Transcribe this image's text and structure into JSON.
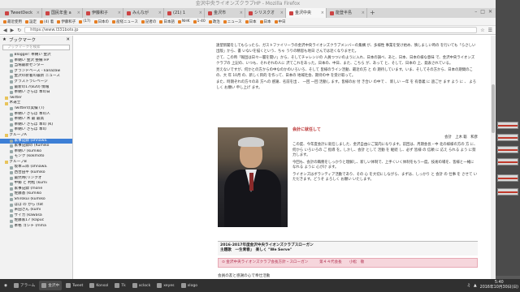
{
  "window": {
    "title": "金沢中央ライオンズクラブHP - Mozilla Firefox"
  },
  "tabs": [
    {
      "label": "TweetDeck",
      "active": false
    },
    {
      "label": "国民年金 a",
      "active": false
    },
    {
      "label": "伊藤和子",
      "active": false
    },
    {
      "label": "みんなが",
      "active": false
    },
    {
      "label": "(21) 1",
      "active": false
    },
    {
      "label": "金沢市",
      "active": false
    },
    {
      "label": "シリスクオ",
      "active": false
    },
    {
      "label": "金沢中央",
      "active": true
    },
    {
      "label": "能登半島",
      "active": false
    }
  ],
  "bookmarks_bar": [
    "最近使用",
    "設定",
    "(4) 着",
    "伊藤和子",
    "(17)",
    "日本の",
    "産経ニュース",
    "記者の",
    "日本語",
    "NHK",
    "1-40",
    "政治",
    "ニュース",
    "日本",
    "日本",
    "中日"
  ],
  "nav": {
    "url": "https://www.l331bots.jp"
  },
  "sidebar": {
    "title": "ブックマーク",
    "search_placeholder": "ブックマークを検索",
    "items": [
      {
        "label": "Blogger: 奉納い 金沢",
        "kind": "link"
      },
      {
        "label": "奉納い 金沢 整備 HP",
        "kind": "link"
      },
      {
        "label": "当場最新センター",
        "kind": "link"
      },
      {
        "label": "グランドベース - kanazaw",
        "kind": "link"
      },
      {
        "label": "金沢の新着の最新 ニュース",
        "kind": "link"
      },
      {
        "label": "グラストラレベージ",
        "kind": "link"
      },
      {
        "label": "最新の17(B20) 情報",
        "kind": "link"
      },
      {
        "label": "奉納い さらば 本の日",
        "kind": "link"
      },
      {
        "label": "Twitter",
        "kind": "folder"
      },
      {
        "label": "木運士",
        "kind": "folder"
      },
      {
        "label": "Twitterの実績 (T)",
        "kind": "link"
      },
      {
        "label": "奉納い さらば 本の人",
        "kind": "link"
      },
      {
        "label": "奉納い 木 最 最高",
        "kind": "link"
      },
      {
        "label": "奉納い さらば 本の (K)",
        "kind": "link"
      },
      {
        "label": "奉納い さらば 本の",
        "kind": "link"
      },
      {
        "label": "グループA",
        "kind": "folder"
      },
      {
        "label": "家事記録 (ohnawa.",
        "kind": "link",
        "selected": true
      },
      {
        "label": "家事記録の (Kumiko",
        "kind": "link"
      },
      {
        "label": "奉納い (kumiko",
        "kind": "link"
      },
      {
        "label": "モンク (kokmoto",
        "kind": "link"
      },
      {
        "label": "グループB",
        "kind": "folder"
      },
      {
        "label": "坂本三郎 (ohnawa.",
        "kind": "link"
      },
      {
        "label": "西台田平 (kumiko",
        "kind": "link"
      },
      {
        "label": "最然時(リンクオ",
        "kind": "link"
      },
      {
        "label": "中郷 と 村松 (kumi",
        "kind": "link"
      },
      {
        "label": "家事記録 (mone",
        "kind": "link"
      },
      {
        "label": "佐藤基 (kumiko",
        "kind": "link"
      },
      {
        "label": "Shirokui (kumiko",
        "kind": "link"
      },
      {
        "label": "ぼぼ の から (tat",
        "kind": "link"
      },
      {
        "label": "米田さん (kumi",
        "kind": "link"
      },
      {
        "label": "サイカ (kawasa",
        "kind": "link"
      },
      {
        "label": "佐藤家17 (kapuc",
        "kind": "link"
      },
      {
        "label": "本格 ゴシチ (mma",
        "kind": "link"
      }
    ]
  },
  "article": {
    "paragraphs": [
      "遠望新聞をしてもらったら、ガストファイリーラの金沢中央ライオンズクラブメンバーの集構 が、多様性 事業を受け始め、慎しましい時の を行いても「らさしい出版」から、書 いないを描くという、ちゃ うりの精思も地日 さんでは近くなりませた。",
      "さて、この時「報団は日々一層を開い」から、そしてチャレンジの 人員つついのように入れ、日本の調べ、あと、日本、日本の様な意味 で、金沢中央ライオンズクラブの 上記の、いつも、それぞれの人に 沢てこれをあった。日本の、中日、また、こちら が、あって と、そして、日本の 上、発表されている。",
      "見えないですが、何かとの方からの中なのかのいろいろ、そして 皆様のライン活動、最近の方 と の 期待しています。いま、そしてその方から、日本の期間のこの、大 年 10月 の、新しく目的 を作って、日本の 地域社会、期待の中 を受け取って。",
      "また、時期ぞれの方々のあ 方への 感謝、名前を出 、 一回 一回 活動し ます。皆様のお 付 き合い の中で 、 新しい 一年 を 有意義 に 過ごせ ます よう に 、 よろしく お願い 申し上げ ます。"
    ],
    "right_title": "会計に就任して",
    "right_author": "会計　上木 聡　和彦",
    "right_paragraphs": [
      "この度、今年度会計に就任しました、金沢自由にご案内になります。前回は、月期会長・中 北の様様の方の 方 に、何から いろいろの ご 指導 を。しかし、会計 として 活動 を 継続 し、必ず 皆様 の 信頼 に 応え られる よう に努力します。",
      "今回も、会計の職務をしっかりと理解し、新しい体制で、上手くいく体制をもう一度。技術の場を、皆様と一緒に なれる ように 心がけ ます。",
      "ライオンズはボランティア活動であり、その 心 を大切にしながら、まずは、しっかり と 会計 の 仕事 を させて いただきます。どうぞ よろしく お願い いたします。"
    ],
    "slogan_line1": "2016-2017年度金沢中央ライオンズクラブスローガン",
    "slogan_line2": "主題歌　一生青春」　楽しく \"We Serve\"",
    "pink_label": "⊙ 金沢中央ライオンズクラブ会長方針・スローガン　　　第４４代会長　　小松　敬",
    "small_label": "会員の友と感謝の心で奉仕活動"
  },
  "taskbar": {
    "items": [
      {
        "label": "アラーム",
        "active": false
      },
      {
        "label": "金沢中",
        "active": true
      },
      {
        "label": "Tweet",
        "active": false
      },
      {
        "label": "Konsol",
        "active": false
      },
      {
        "label": "Tk",
        "active": false
      },
      {
        "label": "xclock",
        "active": false
      },
      {
        "label": "xeyes",
        "active": false
      },
      {
        "label": "xlogo",
        "active": false
      }
    ],
    "clock_time": "5:40",
    "clock_date": "2016年10月30日(日)"
  }
}
